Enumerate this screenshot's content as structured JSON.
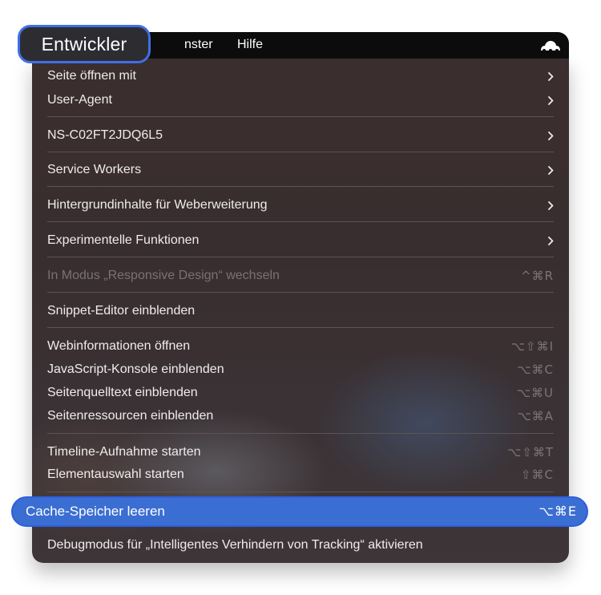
{
  "menubar": {
    "active_menu": "Entwickler",
    "items": [
      "nster",
      "Hilfe"
    ],
    "status_icon": "cloud-icon"
  },
  "menu": {
    "items": [
      {
        "label": "Seite öffnen mit",
        "submenu": true
      },
      {
        "label": "User-Agent",
        "submenu": true
      },
      {
        "label": "NS-C02FT2JDQ6L5",
        "submenu": true
      },
      {
        "label": "Service Workers",
        "submenu": true
      },
      {
        "label": "Hintergrundinhalte für Weberweiterung",
        "submenu": true
      },
      {
        "label": "Experimentelle Funktionen",
        "submenu": true
      },
      {
        "label": "In Modus „Responsive Design“ wechseln",
        "shortcut": "^⌘R",
        "disabled": true
      },
      {
        "label": "Snippet-Editor einblenden"
      },
      {
        "label": "Webinformationen öffnen",
        "shortcut": "⌥⇧⌘I"
      },
      {
        "label": "JavaScript-Konsole einblenden",
        "shortcut": "⌥⌘C"
      },
      {
        "label": "Seitenquelltext einblenden",
        "shortcut": "⌥⌘U"
      },
      {
        "label": "Seitenressourcen einblenden",
        "shortcut": "⌥⌘A"
      },
      {
        "label": "Timeline-Aufnahme starten",
        "shortcut": "⌥⇧⌘T"
      },
      {
        "label": "Elementauswahl starten",
        "shortcut": "⇧⌘C"
      },
      {
        "label": "Cache-Speicher leeren",
        "shortcut": "⌥⌘E",
        "highlighted": true
      },
      {
        "label": "Debugmodus für „Intelligentes Verhindern von Tracking“ aktivieren"
      }
    ]
  },
  "colors": {
    "menubar_bg": "#0c0c0d",
    "menu_bg": "#392e2f",
    "highlight": "#3b6ed2",
    "accent_border": "#3f6fe6",
    "text": "#f0ecec",
    "disabled_text": "#7a7272"
  }
}
